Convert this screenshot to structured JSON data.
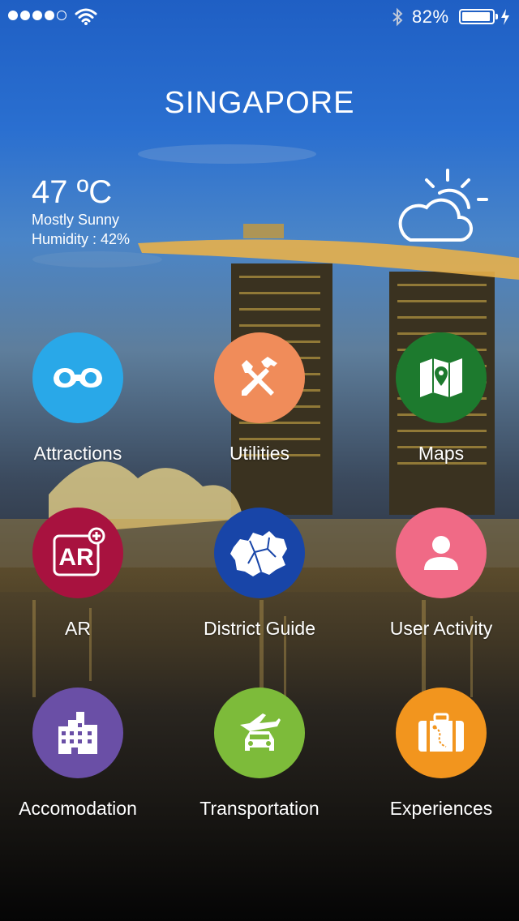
{
  "status_bar": {
    "signal_dots": 5,
    "signal_filled": 4,
    "battery_percent": "82%",
    "battery_level": 0.82
  },
  "header": {
    "title": "SINGAPORE"
  },
  "weather": {
    "temperature": "47 ºC",
    "condition": "Mostly Sunny",
    "humidity": "Humidity : 42%",
    "icon": "partly-sunny-icon"
  },
  "menu": [
    {
      "label": "Attractions",
      "icon": "binoculars-icon",
      "color": "#29a8e8"
    },
    {
      "label": "Utilities",
      "icon": "tools-icon",
      "color": "#f08c5a"
    },
    {
      "label": "Maps",
      "icon": "map-icon",
      "color": "#1d7a2e"
    },
    {
      "label": "AR",
      "icon": "ar-icon",
      "color": "#a8123f"
    },
    {
      "label": "District Guide",
      "icon": "district-map-icon",
      "color": "#1845a8"
    },
    {
      "label": "User Activity",
      "icon": "user-icon",
      "color": "#f06a86"
    },
    {
      "label": "Accomodation",
      "icon": "building-icon",
      "color": "#6a4fa6"
    },
    {
      "label": "Transportation",
      "icon": "transport-icon",
      "color": "#7dbb3a"
    },
    {
      "label": "Experiences",
      "icon": "suitcase-icon",
      "color": "#f2951e"
    }
  ]
}
